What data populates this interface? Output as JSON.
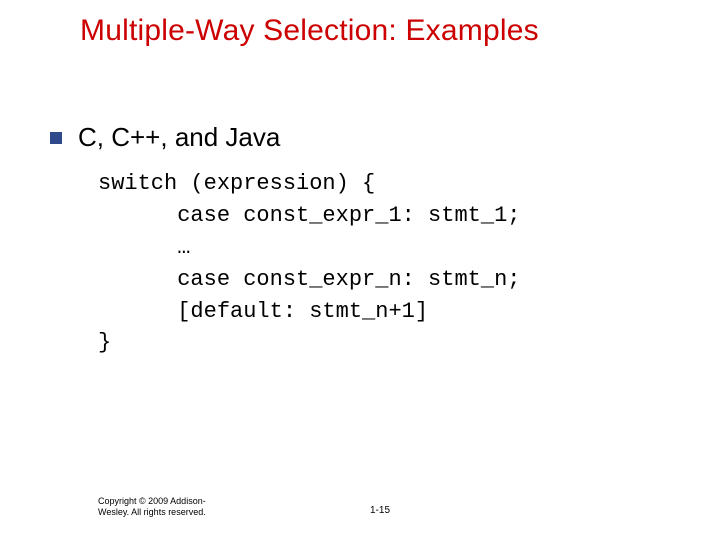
{
  "title": "Multiple-Way Selection: Examples",
  "bullet": "C, C++, and Java",
  "code": {
    "l1": "switch (expression) {",
    "l2": "      case const_expr_1: stmt_1;",
    "l3": "      …",
    "l4": "      case const_expr_n: stmt_n;",
    "l5": "      [default: stmt_n+1]",
    "l6": "}"
  },
  "copyright_l1": "Copyright © 2009 Addison-",
  "copyright_l2": "Wesley. All rights reserved.",
  "page_num": "1-15"
}
